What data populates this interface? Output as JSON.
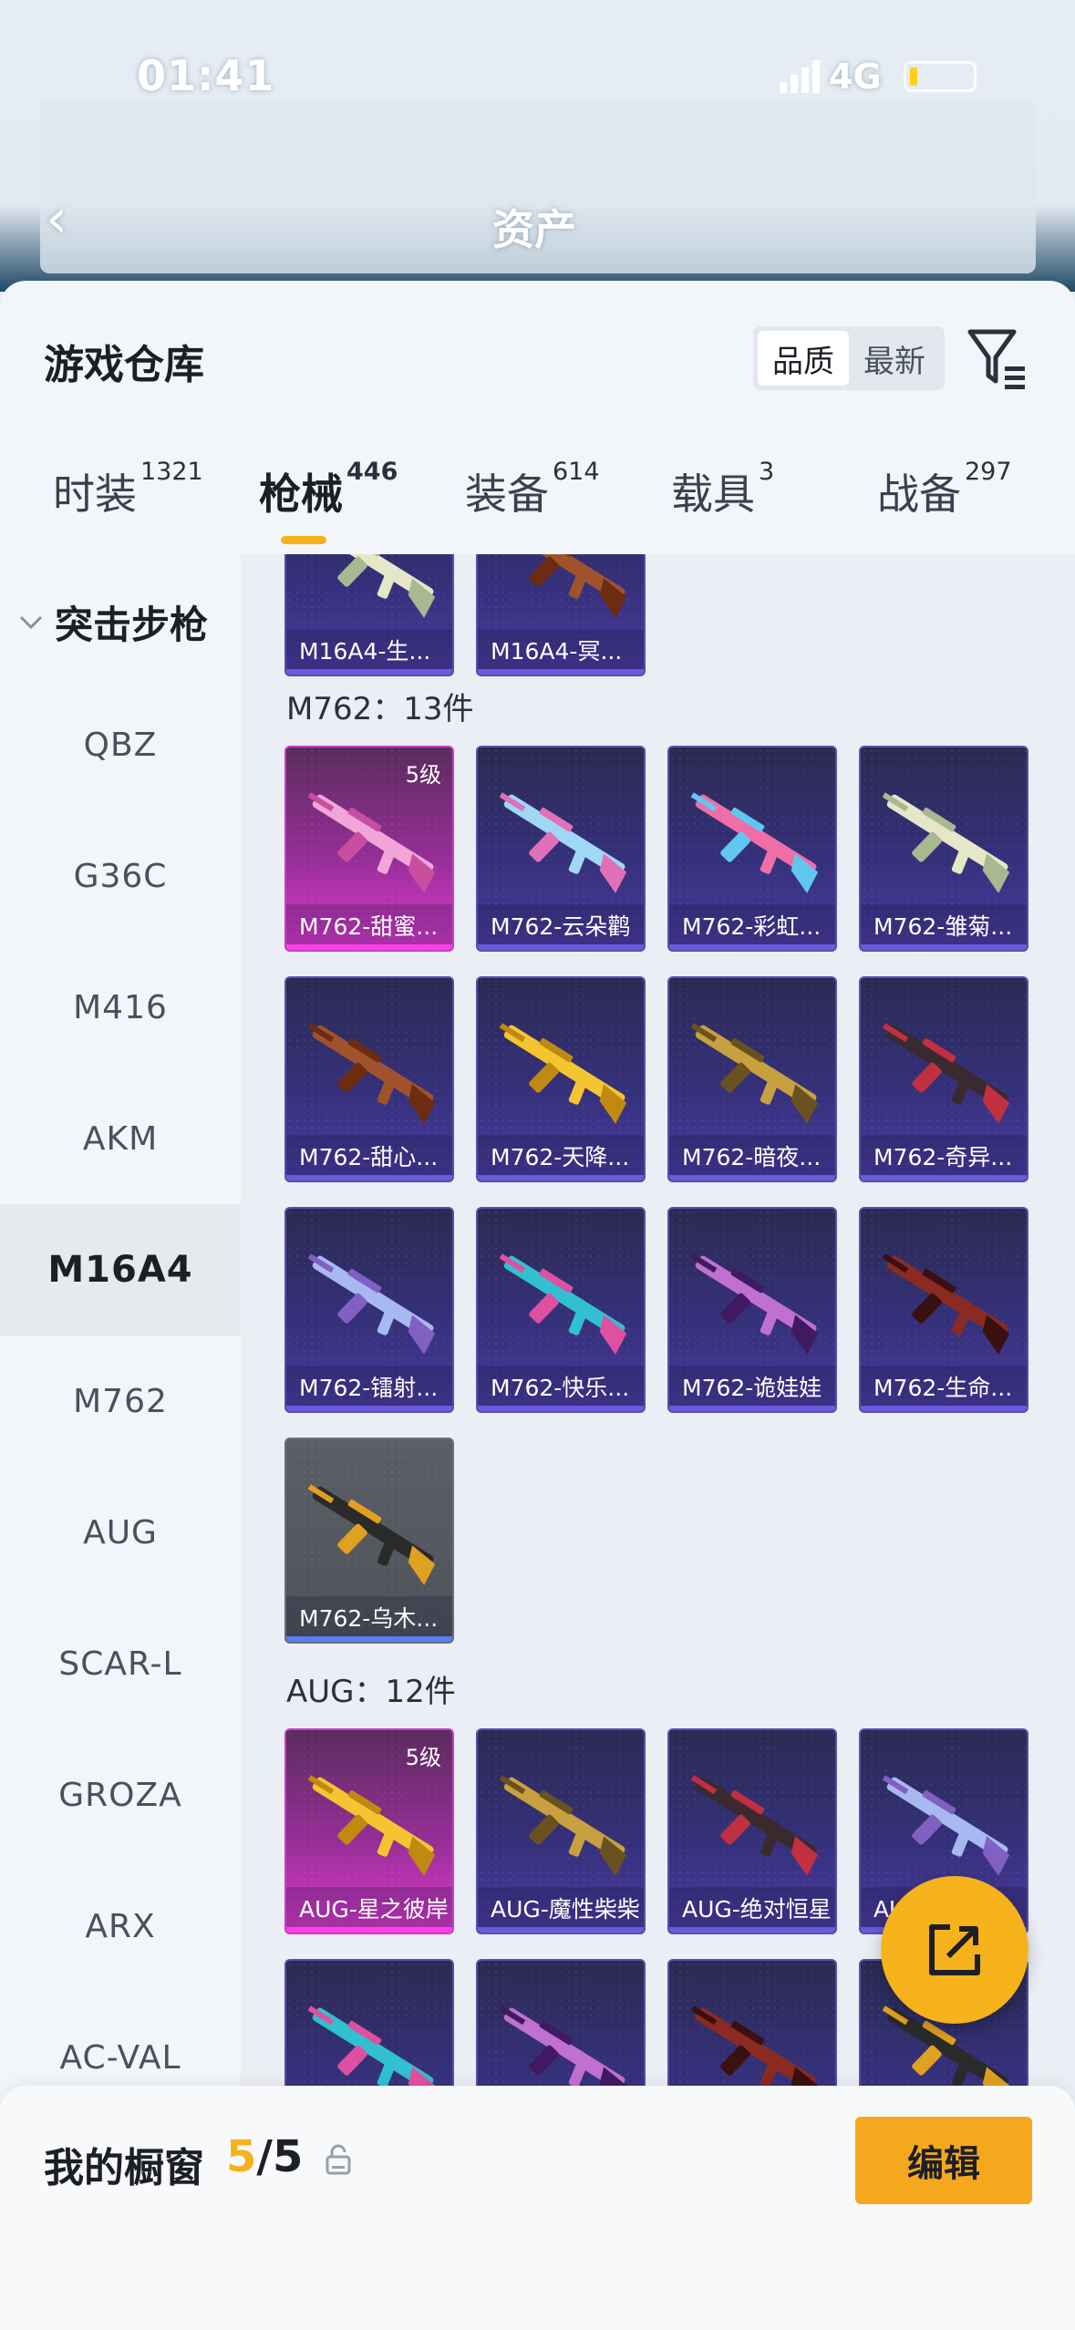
{
  "status": {
    "time": "01:41",
    "network": "4G"
  },
  "backdrop": {
    "title": "资产"
  },
  "sheet": {
    "title": "游戏仓库",
    "sort": {
      "quality": "品质",
      "newest": "最新",
      "selected": "品质"
    }
  },
  "tabs": [
    {
      "label": "时装",
      "count": "1321"
    },
    {
      "label": "枪械",
      "count": "446"
    },
    {
      "label": "装备",
      "count": "614"
    },
    {
      "label": "载具",
      "count": "3"
    },
    {
      "label": "战备",
      "count": "297"
    }
  ],
  "active_tab": "枪械",
  "sidebar": {
    "group": "突击步枪",
    "items": [
      "QBZ",
      "G36C",
      "M416",
      "AKM",
      "M16A4",
      "M762",
      "AUG",
      "SCAR-L",
      "GROZA",
      "ARX",
      "AC-VAL"
    ],
    "active": "M16A4"
  },
  "sections": {
    "top_row": [
      {
        "name": "M16A4-生...",
        "rarity": "purple"
      },
      {
        "name": "M16A4-冥...",
        "rarity": "purple"
      }
    ],
    "m762": {
      "title": "M762：13件",
      "items": [
        {
          "name": "M762-甜蜜...",
          "rarity": "gold",
          "level": "5级"
        },
        {
          "name": "M762-云朵鹳",
          "rarity": "purple"
        },
        {
          "name": "M762-彩虹...",
          "rarity": "purple"
        },
        {
          "name": "M762-雏菊...",
          "rarity": "purple"
        },
        {
          "name": "M762-甜心...",
          "rarity": "purple"
        },
        {
          "name": "M762-天降...",
          "rarity": "purple"
        },
        {
          "name": "M762-暗夜...",
          "rarity": "purple"
        },
        {
          "name": "M762-奇异...",
          "rarity": "purple"
        },
        {
          "name": "M762-镭射...",
          "rarity": "purple"
        },
        {
          "name": "M762-快乐...",
          "rarity": "purple"
        },
        {
          "name": "M762-诡娃娃",
          "rarity": "purple"
        },
        {
          "name": "M762-生命...",
          "rarity": "purple"
        },
        {
          "name": "M762-乌木...",
          "rarity": "grey"
        }
      ]
    },
    "aug": {
      "title": "AUG：12件",
      "items": [
        {
          "name": "AUG-星之彼岸",
          "rarity": "gold",
          "level": "5级"
        },
        {
          "name": "AUG-魔性柴柴",
          "rarity": "purple"
        },
        {
          "name": "AUG-绝对恒星",
          "rarity": "purple"
        },
        {
          "name": "AU...",
          "rarity": "purple"
        },
        {
          "name": "",
          "rarity": "purple"
        },
        {
          "name": "",
          "rarity": "purple"
        },
        {
          "name": "",
          "rarity": "purple"
        },
        {
          "name": "",
          "rarity": "purple"
        }
      ]
    }
  },
  "showcase": {
    "title": "我的橱窗",
    "current": "5",
    "total": "/5",
    "edit_label": "编辑"
  },
  "colors": {
    "accent": "#f5b21b",
    "purple_card": "#35307a",
    "gold_card": "#962e96"
  }
}
